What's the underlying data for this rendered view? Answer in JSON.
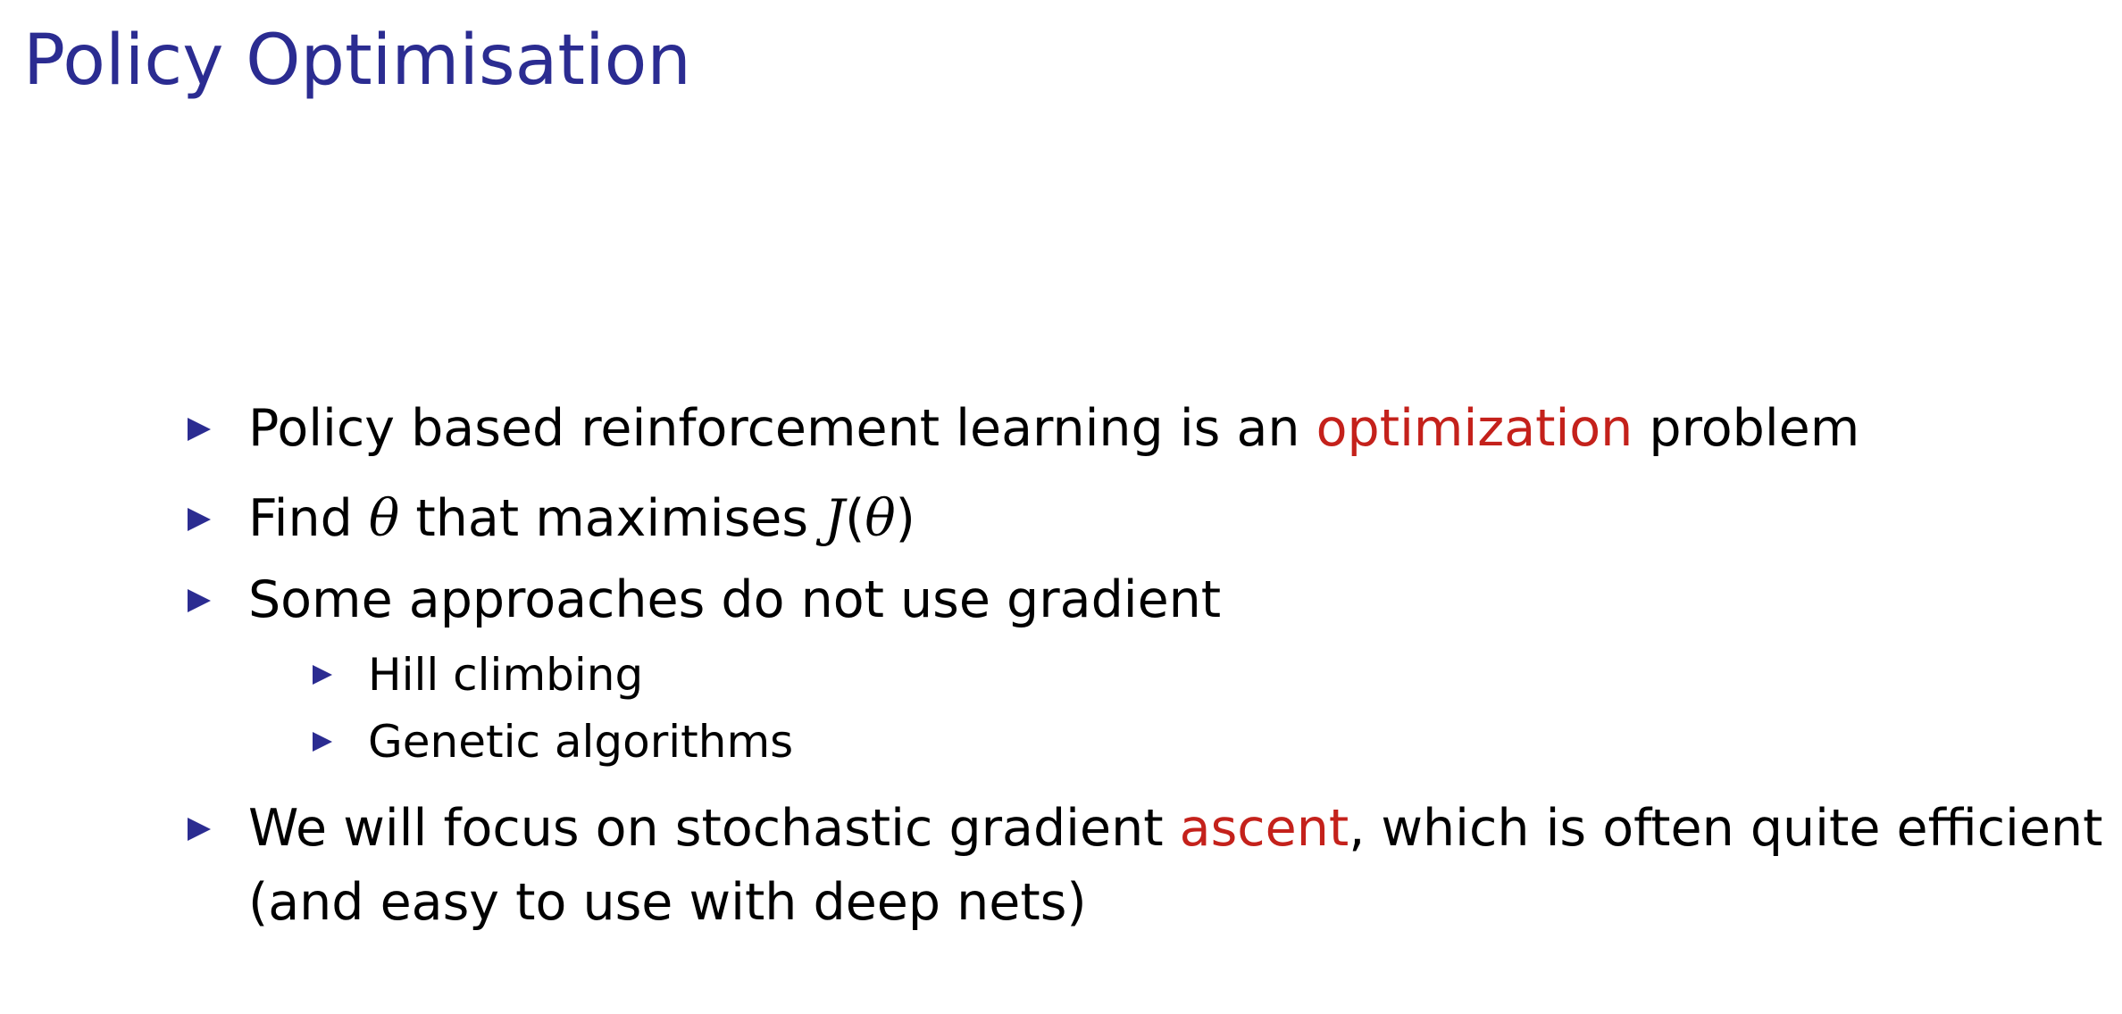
{
  "slide": {
    "title": "Policy Optimisation",
    "colors": {
      "title": "#2b2c91",
      "bullet": "#2b2c91",
      "accent": "#c4211b",
      "text": "#000000"
    },
    "bullets": [
      {
        "pre": "Policy based reinforcement learning is an ",
        "accent": "optimization",
        "post": " problem"
      },
      {
        "pre": "Find ",
        "math1": "θ",
        "mid": " that maximises ",
        "math2": "J",
        "paren_open": "(",
        "math3": "θ",
        "paren_close": ")"
      },
      {
        "text": "Some approaches do not use gradient",
        "sub": [
          "Hill climbing",
          "Genetic algorithms"
        ]
      },
      {
        "pre": "We will focus on stochastic gradient ",
        "accent": "ascent",
        "post": ", which is often quite efficient",
        "line2": "(and easy to use with deep nets)"
      }
    ]
  }
}
